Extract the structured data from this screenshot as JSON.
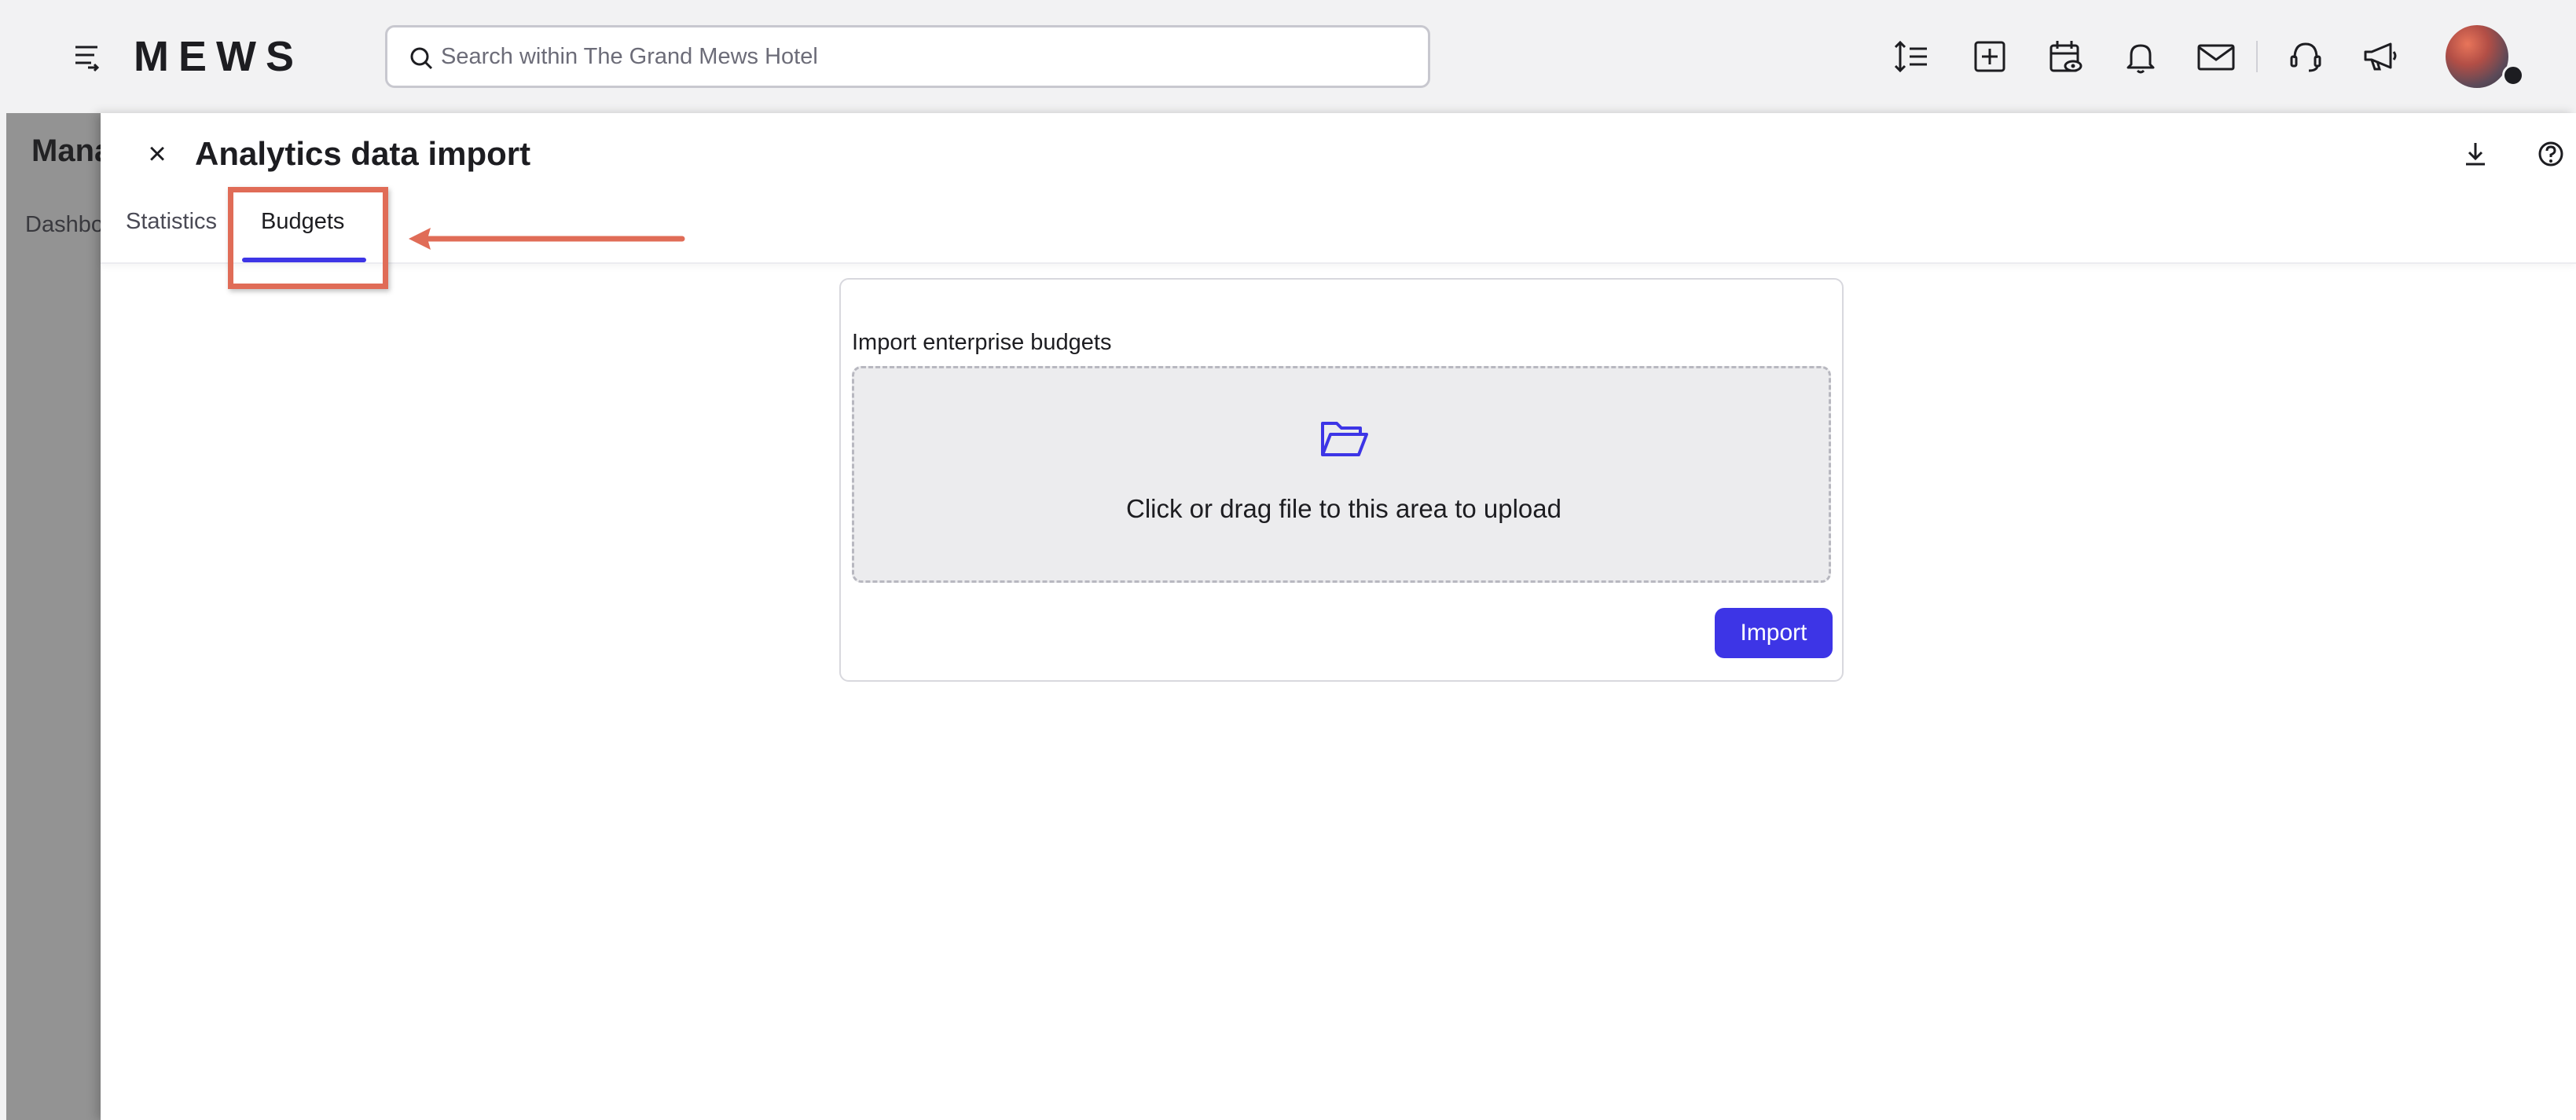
{
  "topbar": {
    "logo_text": "MEWS",
    "search": {
      "placeholder": "Search within The Grand Mews Hotel",
      "value": ""
    },
    "icons": [
      "text-height-icon",
      "add-square-icon",
      "calendar-view-icon",
      "bell-icon",
      "mail-icon",
      "support-icon",
      "megaphone-icon"
    ]
  },
  "background_page": {
    "title": "Mana",
    "tab": "Dashbo"
  },
  "drawer": {
    "title": "Analytics data import",
    "close_label": "×",
    "tabs": [
      {
        "label": "Statistics",
        "active": false
      },
      {
        "label": "Budgets",
        "active": true
      }
    ]
  },
  "import_card": {
    "label": "Import enterprise budgets",
    "dropzone_text": "Click or drag file to this area to upload",
    "import_button": "Import"
  },
  "colors": {
    "accent": "#3d35e6",
    "annotation": "#e06c57",
    "topbar_bg": "#f2f2f3"
  }
}
